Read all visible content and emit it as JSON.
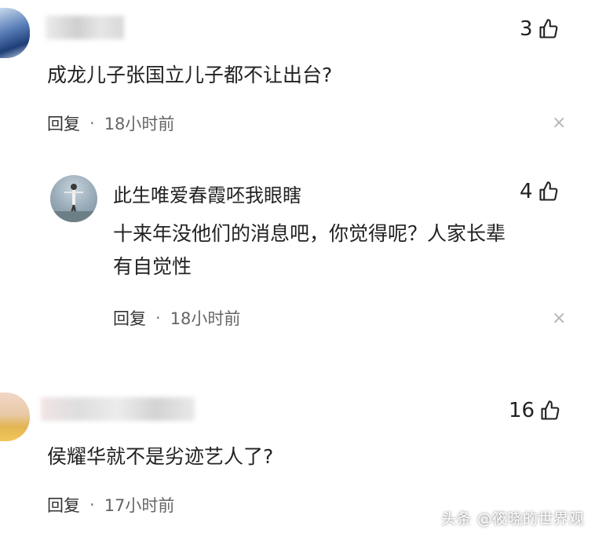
{
  "comments": [
    {
      "likes": "3",
      "text": "成龙儿子张国立儿子都不让出台?",
      "reply_label": "回复",
      "separator": "·",
      "time": "18小时前",
      "close": "×",
      "replies": [
        {
          "username": "此生唯爱春霞呸我眼瞎",
          "likes": "4",
          "text_line1": "十来年没他们的消息吧，你觉得呢？人家长辈",
          "text_line2": "有自觉性",
          "reply_label": "回复",
          "separator": "·",
          "time": "18小时前",
          "close": "×"
        }
      ]
    },
    {
      "likes": "16",
      "text": "侯耀华就不是劣迹艺人了?",
      "reply_label": "回复",
      "separator": "·",
      "time": "17小时前"
    }
  ],
  "watermark": "头条 @筱晓的世界观",
  "icons": {
    "like": "thumbs-up-icon",
    "close": "close-icon"
  }
}
